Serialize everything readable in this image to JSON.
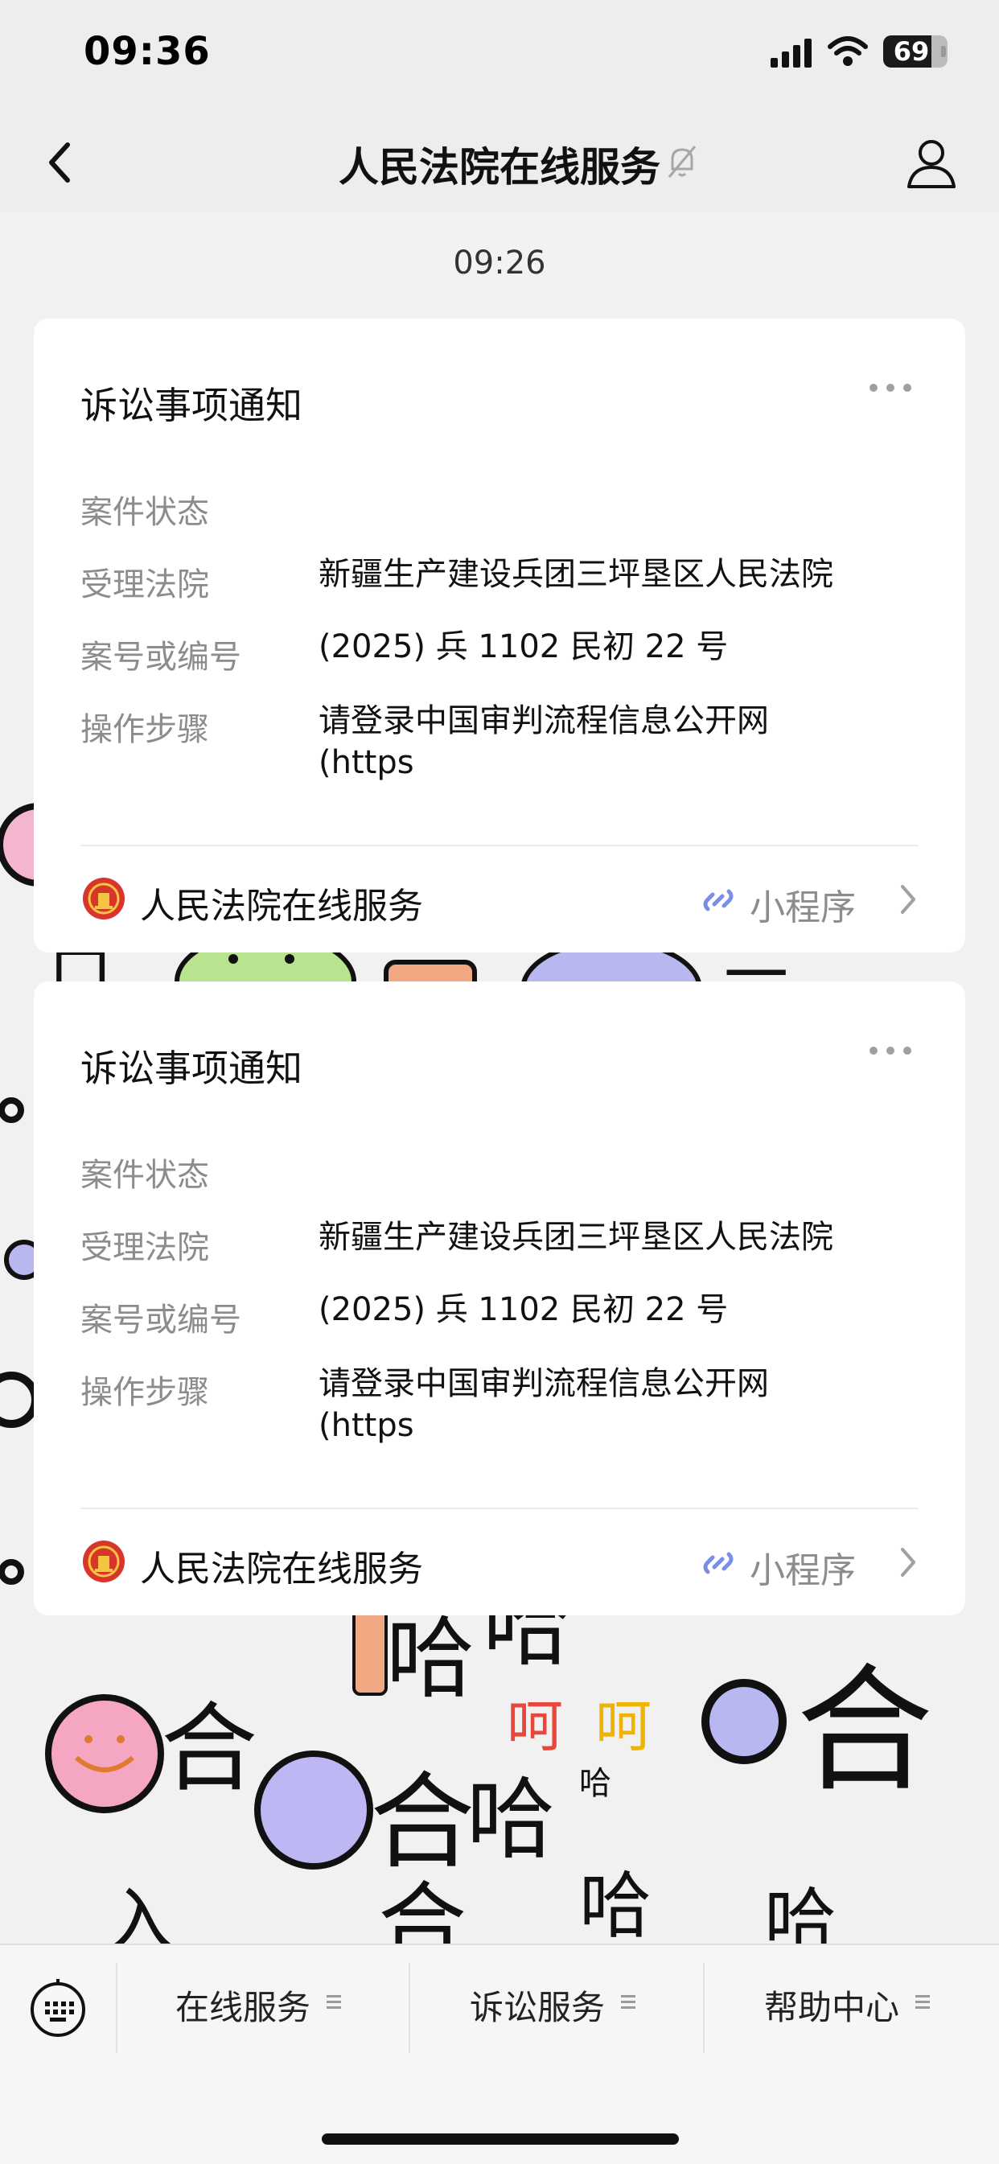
{
  "status_bar": {
    "time": "09:36",
    "battery": "69"
  },
  "header": {
    "title": "人民法院在线服务"
  },
  "timestamp": "09:26",
  "cards": [
    {
      "title": "诉讼事项通知",
      "rows": [
        {
          "label": "案件状态",
          "value": ""
        },
        {
          "label": "受理法院",
          "value": "新疆生产建设兵团三坪垦区人民法院"
        },
        {
          "label": "案号或编号",
          "value": "(2025) 兵 1102 民初 22 号"
        },
        {
          "label": "操作步骤",
          "value": "请登录中国审判流程信息公开网 (https"
        }
      ],
      "footer_name": "人民法院在线服务",
      "mini_program_label": "小程序"
    },
    {
      "title": "诉讼事项通知",
      "rows": [
        {
          "label": "案件状态",
          "value": ""
        },
        {
          "label": "受理法院",
          "value": "新疆生产建设兵团三坪垦区人民法院"
        },
        {
          "label": "案号或编号",
          "value": "(2025) 兵 1102 民初 22 号"
        },
        {
          "label": "操作步骤",
          "value": "请登录中国审判流程信息公开网 (https"
        }
      ],
      "footer_name": "人民法院在线服务",
      "mini_program_label": "小程序"
    }
  ],
  "bottom_menu": {
    "items": [
      "在线服务",
      "诉讼服务",
      "帮助中心"
    ]
  },
  "background_doodles": [
    "哈",
    "哈",
    "哈",
    "哈",
    "哈",
    "哈",
    "哈",
    "哈",
    "呵呵"
  ],
  "icons": {
    "back": "chevron-left-icon",
    "mute": "bell-off-icon",
    "profile": "person-icon",
    "more": "ellipsis-icon",
    "badge": "court-emblem-icon",
    "link": "mini-program-link-icon",
    "chevron": "chevron-right-icon",
    "keyboard": "keyboard-icon",
    "menu": "menu-lines-icon"
  },
  "colors": {
    "background": "#ededed",
    "card": "#ffffff",
    "label": "#8c8c8c",
    "accent": "#7b8ee6",
    "emblem": "#d8362a"
  }
}
